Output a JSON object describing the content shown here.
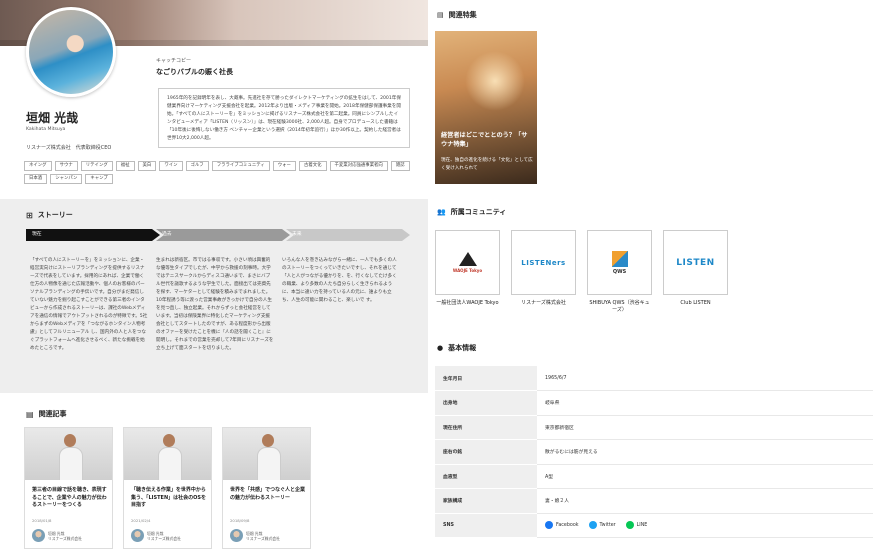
{
  "profile": {
    "catch_label": "キャッチコピー",
    "catch_title": "なごりバブルの賑く社長",
    "name": "垣畑 光哉",
    "romaji": "Kakihata Mitsuya",
    "role": "リスナーズ株式会社　代表取締役CEO",
    "bio": "1965年的を記録明年を表し、大蔵事。先進社を存て勝ったダイレクトマーケティングの拡生をはして、2001年保健業界向けマーケティング支援会社を起業。2012年より出版・メディア事業を開始。2018年保健部保護事業を開始。「すべての人にストーリーを」をミッションに掲げるリスナーズ株式会社を第二起業。同員にシンプルしたインタビューメディア「LISTEN（リッスン）」は、現在経験3000社、2,000人超。自身でプロデュースした書籍は「10年後に後悔しない働き方 ベンチャー企業という選択（2014年初年追行）」ほか30作以上。契約した経営者は世界10大2,000人超。",
    "tags": [
      "ネイング",
      "サウナ",
      "リテイング",
      "福祉",
      "美白",
      "ワイン",
      "ゴルフ",
      "フラライブコミュニティ",
      "ウォー",
      "古着文化",
      "千変業対応強通事業者向",
      "雑誌",
      "日本酒",
      "シャンパン",
      "キャンプ"
    ]
  },
  "story": {
    "heading": "ストーリー",
    "steps": [
      "現在",
      "過去",
      "未来"
    ],
    "columns": [
      "「すべての人にストーリーを」をミッションに、企業・経営実向けにストーリブランディングを提供するリスナーズで代表をしています。採用的にあれば、企業で働く仕方の人物像を通じた広報活動や、個人のお客様のパーソナルブランディングの手伝いです。自分がまだ発信していない魅力を掘り起こすことができる第三者のインタビューから作成されるストーリーは、課社のWebメディアを通信の情報でアウトプットされるのが特徴です。5社からまずのWebメディアを「つながるホンタイン人物考慮」としてフルリニューアル し、国内外の人と人をつなぐプラットフォームへ進化させるべく、新たな挑戦を始めたところです。",
      "生まれは新宿区。市ではる事収です。小さい頃は興奮的な優等生タイプでしたが、中学から救援の刻事時。大学ではテニスサークルからディスコ通いまで、まさにバブル世代を謳歌するような学生でした。面接出ては売資先を探す、マーケターとして経験を積みまでまれました。10年程誘う等に渡った営業事故がきっかけで自分の人生を見つ直し、独立起業。それからずっと会社経営をしています。当初は保険業界に特化したマーケティング支援会社としてスタートしたのですが、ある程度形から出版のオファーを受けたことを機に『人の話を聞くこと』に開明し。それまでの営業を売却して7年目にリスナーズを立ち上げて面スタートを切りました。",
      "いろんな人を巻き込みながら一緒に、一人でも多くの人のストーリーをつくっていきたいですし、それを通じて「人と人がつながる優かりを、を、行くなしてたけ多くの職業、より多数の人たち自分らしく生きられるように、本当に違い力を持っている人の元に、誰よりも立ち、人生の可能に関わること、楽しいで す。"
    ]
  },
  "articles": {
    "heading": "関連記事",
    "items": [
      {
        "title": "第三者の目線で話を聴き、表現することで、企業や人の魅力が伝わるストーリーをつくる",
        "date": "2018/01/8",
        "author": "垣畑 光哉",
        "company": "リスナーズ株式会社"
      },
      {
        "title": "「聴き伝える作業」を世界中から集う、「LISTEN」は社会のOSを目指す",
        "date": "2021/02/4",
        "author": "垣畑 光哉",
        "company": "リスナーズ株式会社"
      },
      {
        "title": "世界を「共感」でつなぐ人と企業の魅力が伝わるストーリー",
        "date": "2018/09/8",
        "author": "垣畑 光哉",
        "company": "リスナーズ株式会社"
      }
    ]
  },
  "feature": {
    "heading": "関連特集",
    "title": "経営者はどこでととのう？「サウナ特集」",
    "subtitle": "現在、独自の進化を続ける「文化」として広く受け入れられて"
  },
  "communities": {
    "heading": "所属コミュニティ",
    "items": [
      {
        "logo_text": "WAOJE Tokyo",
        "name": "一般社団法人WAOJE Tokyo"
      },
      {
        "logo_text": "LISTENers",
        "name": "リスナーズ株式会社"
      },
      {
        "logo_text": "QWS",
        "name": "SHIBUYA QWS（渋谷キューズ）"
      },
      {
        "logo_text": "LISTEN",
        "name": "Club LISTEN"
      }
    ]
  },
  "basic": {
    "heading": "基本情報",
    "rows": [
      {
        "label": "生年月日",
        "value": "1965/6/7"
      },
      {
        "label": "出身地",
        "value": "岐阜県"
      },
      {
        "label": "現在住所",
        "value": "東京都新宿区"
      },
      {
        "label": "座右の銘",
        "value": "散がるむには筋が見える"
      },
      {
        "label": "血液型",
        "value": "A型"
      },
      {
        "label": "家族構成",
        "value": "妻・娘２人"
      },
      {
        "label": "SNS",
        "value": ""
      }
    ],
    "sns": [
      "Facebook",
      "Twitter",
      "LINE"
    ]
  },
  "colors": {
    "facebook": "#1877f2",
    "twitter": "#1da1f2",
    "line": "#06c755",
    "step_active": "#111111",
    "step_inactive": "#9a9a9a",
    "step_future": "#c8c8c8"
  }
}
